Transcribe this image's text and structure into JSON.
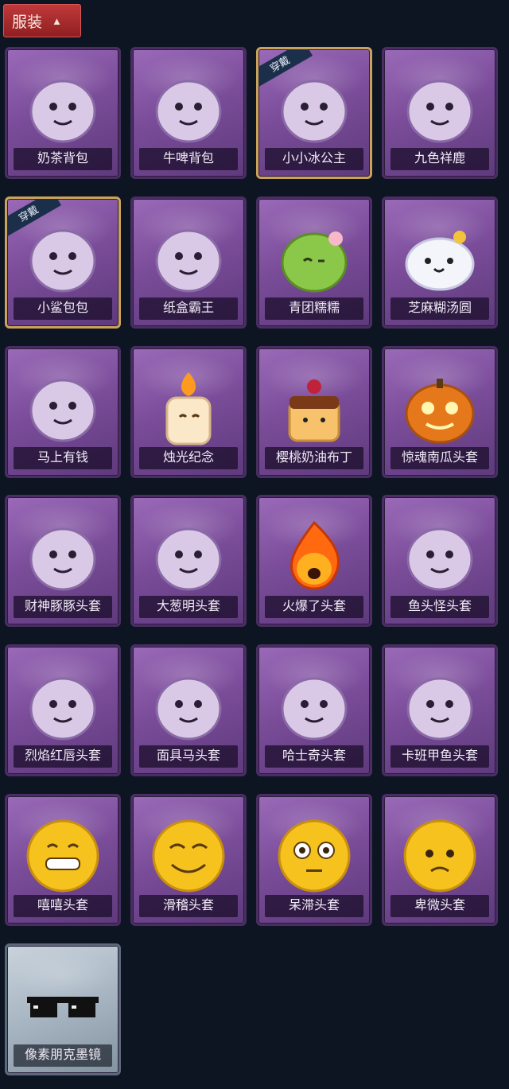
{
  "header": {
    "title": "服装",
    "caret": "^"
  },
  "equipped_badge": "穿戴",
  "items": [
    {
      "name": "奶茶背包",
      "art": "milk-tea-backpack-art",
      "equipped": false
    },
    {
      "name": "牛啤背包",
      "art": "beer-backpack-art",
      "equipped": false
    },
    {
      "name": "小小冰公主",
      "art": "ice-princess-art",
      "equipped": true
    },
    {
      "name": "九色祥鹿",
      "art": "deer-art",
      "equipped": false
    },
    {
      "name": "小鲨包包",
      "art": "shark-bag-art",
      "equipped": true
    },
    {
      "name": "纸盒霸王",
      "art": "box-dino-art",
      "equipped": false
    },
    {
      "name": "青团糯糯",
      "art": "green-rice-ball-art",
      "equipped": false
    },
    {
      "name": "芝麻糊汤圆",
      "art": "tangyuan-art",
      "equipped": false
    },
    {
      "name": "马上有钱",
      "art": "horse-art",
      "equipped": false
    },
    {
      "name": "烛光纪念",
      "art": "candle-art",
      "equipped": false
    },
    {
      "name": "樱桃奶油布丁",
      "art": "pudding-art",
      "equipped": false
    },
    {
      "name": "惊魂南瓜头套",
      "art": "pumpkin-art",
      "equipped": false
    },
    {
      "name": "财神豚豚头套",
      "art": "capybara-art",
      "equipped": false
    },
    {
      "name": "大葱明头套",
      "art": "scallion-art",
      "equipped": false
    },
    {
      "name": "火爆了头套",
      "art": "fire-art",
      "equipped": false
    },
    {
      "name": "鱼头怪头套",
      "art": "fish-head-art",
      "equipped": false
    },
    {
      "name": "烈焰红唇头套",
      "art": "pikachu-mask-art",
      "equipped": false
    },
    {
      "name": "面具马头套",
      "art": "horse-mask-art",
      "equipped": false
    },
    {
      "name": "哈士奇头套",
      "art": "husky-art",
      "equipped": false
    },
    {
      "name": "卡班甲鱼头套",
      "art": "whale-art",
      "equipped": false
    },
    {
      "name": "嘻嘻头套",
      "art": "grin-emoji-art",
      "equipped": false
    },
    {
      "name": "滑稽头套",
      "art": "smirk-emoji-art",
      "equipped": false
    },
    {
      "name": "呆滞头套",
      "art": "flushed-emoji-art",
      "equipped": false
    },
    {
      "name": "卑微头套",
      "art": "pleading-emoji-art",
      "equipped": false
    },
    {
      "name": "像素朋克墨镜",
      "art": "pixel-sunglasses-art",
      "equipped": false,
      "silver": true
    }
  ]
}
